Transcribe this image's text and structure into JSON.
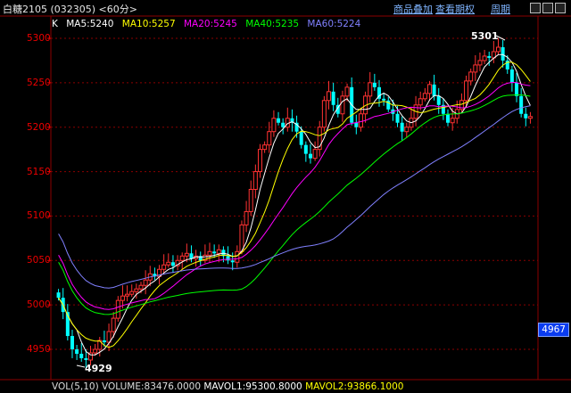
{
  "header": {
    "title": "白糖2105 (032305) <60分>",
    "menu": [
      "商品叠加",
      "查看期权",
      "周期"
    ]
  },
  "indicators": {
    "k_label": "K",
    "ma5": "MA5:5240",
    "ma10": "MA10:5257",
    "ma20": "MA20:5245",
    "ma40": "MA40:5235",
    "ma60": "MA60:5224"
  },
  "colors": {
    "up": "#ff3232",
    "down": "#00ffff",
    "ma5": "#ffffff",
    "ma10": "#ffff00",
    "ma20": "#ff00ff",
    "ma40": "#00ff00",
    "ma60": "#8080ff",
    "grid": "#8b0000"
  },
  "annotations": {
    "high": "5301",
    "low": "4929",
    "price_tag": "4967"
  },
  "volume": {
    "vol_label": "VOL(5,10)",
    "volume": "VOLUME:83476.0000",
    "mavol1": "MAVOL1:95300.8000",
    "mavol2": "MAVOL2:93866.1000"
  },
  "chart_data": {
    "type": "candlestick",
    "y_ticks": [
      "5300",
      "5250",
      "5200",
      "5150",
      "5100",
      "5050",
      "5000",
      "4950"
    ],
    "ylim": [
      4933,
      5310
    ],
    "high_value": 5301,
    "low_value": 4929,
    "series": {
      "close": [
        5008,
        4992,
        4965,
        4950,
        4945,
        4940,
        4938,
        4946,
        4950,
        4960,
        4958,
        4970,
        4985,
        5005,
        5010,
        5012,
        5015,
        5018,
        5022,
        5028,
        5035,
        5032,
        5040,
        5045,
        5048,
        5044,
        5050,
        5055,
        5058,
        5052,
        5055,
        5050,
        5056,
        5060,
        5058,
        5062,
        5055,
        5050,
        5048,
        5060,
        5090,
        5105,
        5130,
        5150,
        5175,
        5180,
        5195,
        5210,
        5205,
        5200,
        5210,
        5205,
        5195,
        5180,
        5170,
        5165,
        5175,
        5200,
        5230,
        5240,
        5225,
        5215,
        5235,
        5245,
        5205,
        5200,
        5215,
        5235,
        5250,
        5245,
        5232,
        5230,
        5220,
        5215,
        5205,
        5195,
        5200,
        5210,
        5225,
        5232,
        5238,
        5248,
        5235,
        5225,
        5215,
        5205,
        5210,
        5220,
        5230,
        5252,
        5262,
        5270,
        5275,
        5280,
        5278,
        5285,
        5290,
        5275,
        5265,
        5250,
        5235,
        5215,
        5210,
        5212
      ],
      "candles_count": 104
    }
  }
}
